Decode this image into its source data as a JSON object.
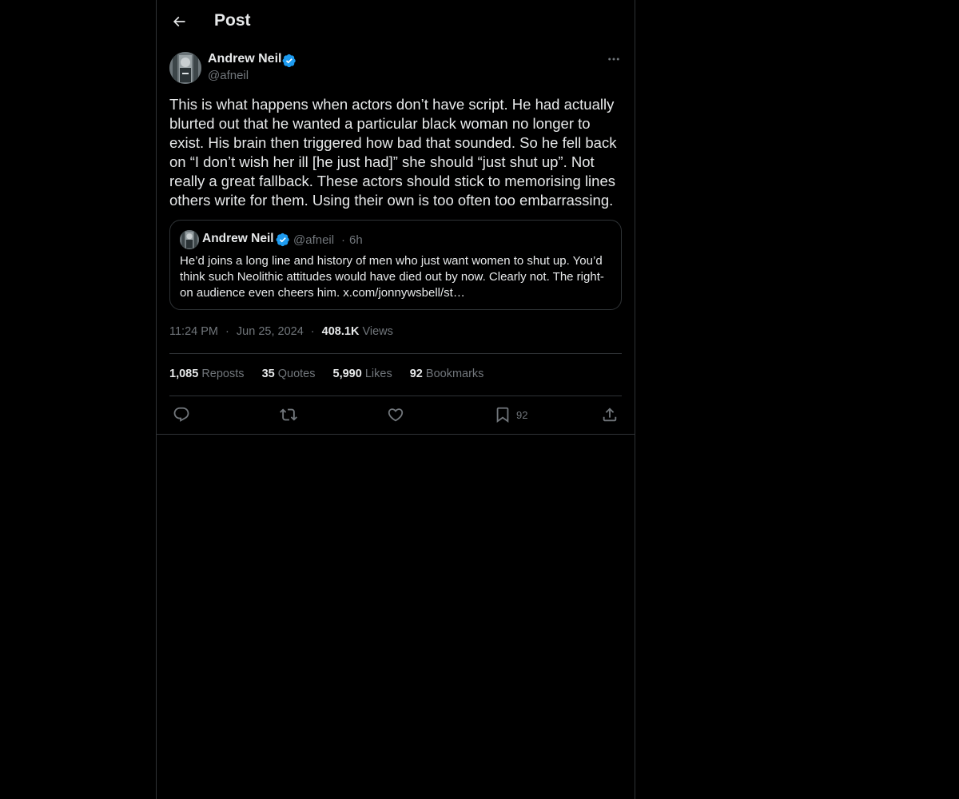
{
  "header": {
    "title": "Post"
  },
  "post": {
    "author_name": "Andrew Neil",
    "author_handle": "@afneil",
    "text": "This is what happens when actors don’t have script. He had actually blurted out that he wanted a particular black woman no longer to exist. His brain then triggered how bad that sounded. So he fell back on “I don’t wish her ill [he just had]” she should “just shut up”. Not really a great fallback. These actors should stick to memorising lines others write for them. Using their own is too often too embarrassing.",
    "time": "11:24 PM",
    "date": "Jun 25, 2024",
    "separator": "·",
    "views_count": "408.1K",
    "views_label": "Views"
  },
  "quote": {
    "author_name": "Andrew Neil",
    "author_handle": "@afneil",
    "separator": "·",
    "age": "6h",
    "text": "He’d joins a long line and history of men who just want women to shut up. You’d think such Neolithic attitudes would have died out by now. Clearly not. The right-on audience even cheers him. x.com/jonnywsbell/st…"
  },
  "stats": {
    "reposts_count": "1,085",
    "reposts_label": "Reposts",
    "quotes_count": "35",
    "quotes_label": "Quotes",
    "likes_count": "5,990",
    "likes_label": "Likes",
    "bookmarks_count": "92",
    "bookmarks_label": "Bookmarks"
  },
  "actions": {
    "reply_icon": "reply-icon",
    "repost_icon": "repost-icon",
    "like_icon": "heart-icon",
    "bookmark_icon": "bookmark-icon",
    "bookmark_count": "92",
    "share_icon": "share-icon"
  },
  "colors": {
    "background": "#000000",
    "text": "#e7e9ea",
    "muted": "#71767b",
    "border": "#2f3336",
    "verified": "#1d9bf0"
  }
}
